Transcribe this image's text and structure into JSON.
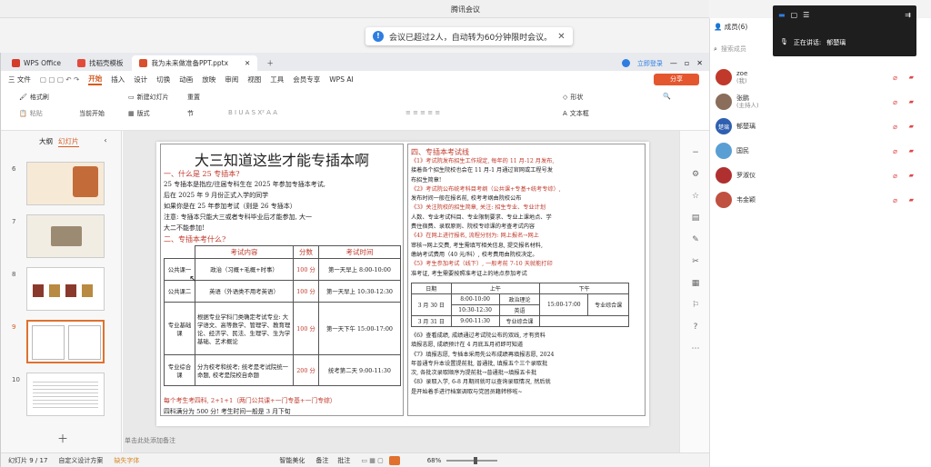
{
  "meeting": {
    "title": "腾讯会议",
    "notice": "会议已超过2人，自动转为60分钟限时会议。",
    "speaking_label": "正在讲话:",
    "speaking_name": "郁楚璃",
    "members_label": "成员(6)",
    "search_placeholder": "搜索成员",
    "participants": [
      {
        "name": "zoe",
        "sub": "(我)",
        "avatar_color": "#c0392b",
        "avatar_text": ""
      },
      {
        "name": "张鹏",
        "sub": "(主持人)",
        "avatar_color": "#8a6d5a",
        "avatar_text": ""
      },
      {
        "name": "郁楚璃",
        "sub": "",
        "avatar_color": "#2f5fb0",
        "avatar_text": "楚璃"
      },
      {
        "name": "国民",
        "sub": "",
        "avatar_color": "#5a9fd4",
        "avatar_text": ""
      },
      {
        "name": "罗淑仪",
        "sub": "",
        "avatar_color": "#b03030",
        "avatar_text": ""
      },
      {
        "name": "韦金颖",
        "sub": "",
        "avatar_color": "#c05040",
        "avatar_text": ""
      }
    ]
  },
  "wps": {
    "tabs": [
      {
        "label": "WPS Office",
        "color": "#d43c2c"
      },
      {
        "label": "找稻壳模板",
        "color": "#e24b3a"
      },
      {
        "label": "我为未来做准备PPT.pptx",
        "color": "#d8502e"
      }
    ],
    "login": "立即登录",
    "menus": [
      "三 文件",
      "开始",
      "插入",
      "设计",
      "切换",
      "动画",
      "放映",
      "审阅",
      "视图",
      "工具",
      "会员专享",
      "WPS AI"
    ],
    "active_menu": "开始",
    "share": "分享",
    "ribbon": {
      "format_painter": "格式刷",
      "paste": "粘贴",
      "from_current": "当前开始",
      "new_slide": "新建幻灯片",
      "layout": "版式",
      "reset": "重置",
      "section": "节",
      "shape": "形状",
      "textbox": "文本框"
    },
    "panel_tabs": [
      "大纲",
      "幻灯片"
    ],
    "slide_numbers": [
      "6",
      "7",
      "8",
      "9",
      "10"
    ],
    "add_note": "单击此处添加备注",
    "status": {
      "slide": "幻灯片 9 / 17",
      "custom": "自定义设计方案",
      "missing_font": "缺失字体",
      "beautify": "智能美化",
      "notes": "备注",
      "comments": "批注",
      "zoom": "68%"
    }
  },
  "slide": {
    "title": "大三知道这些才能专插本啊",
    "sec1": "一、什么是 25 专插本?",
    "p1": "25 专插本是指应/往届专科生在 2025 年参加专插本考试,",
    "p2": "后在 2025 年 9 月份正式入学的同学",
    "p3": "如果你是在 25 年参加考试（则是 26 专插本）",
    "p4": "注意: 专插本只能大三或者专科毕业后才能参加, 大一",
    "p5": "大二不能参加!",
    "sec2": "二、专插本考什么?",
    "table_headers": [
      "考试内容",
      "分数",
      "考试时间"
    ],
    "rows": [
      {
        "name": "公共课一",
        "content": "政治（习概+毛概+时事）",
        "score": "100 分",
        "time": "第一天早上 8:00-10:00"
      },
      {
        "name": "公共课二",
        "content": "英语（外语类不用考英语）",
        "score": "100 分",
        "time": "第一天早上 10:30-12:30"
      },
      {
        "name": "专业基础课",
        "content": "根据专业学科门类确定考试专业: 大学语文、高等数学、管理学、教育理论、经济学、民法、生理学、生为学基础、艺术概论",
        "score": "100 分",
        "time": "第一天下午 15:00-17:00"
      },
      {
        "name": "专业综合课",
        "content": "分为校考和统考; 统考是考试院统一命题, 校考是院校自命题",
        "score": "200 分",
        "time": "统考第二天 9:00-11:30"
      }
    ],
    "foot1": "每个考生考四科, 2+1+1（两门公共课+一门专基+一门专综）",
    "foot2": "四科满分为 500 分! 考生时间一般是 3 月下旬",
    "r_sec": "四、专插本考试线",
    "r_lines": [
      "《1》考试院发布招生工作规定, 每年的 11 月-12 月发布,",
      "接着各个招生院校也会在 11 月-1 月通过官网或工程号发",
      "布招生简章!",
      "《2》考试院公布统考科目考纲（公共课+专基+统考专综）,",
      "发布时间一般在报名前, 校考考纲由院校公布",
      "《3》关注院校的招生简章, 关注: 招生专业、专业计划",
      "人数、专业考试科目、专业限制要求、专业上课地点、学",
      "费住宿费、录取原则、院校专综课的考查考试内容",
      "《4》在网上进行报名, 流程分别为: 网上报名→网上",
      "审核→网上交费, 考生需填写相关信息, 提交报名材料,",
      "缴纳考试费用（40 元/科）, 校考费用由院校决定。",
      "《5》考生参加考试（线下）, 一般考前 7-10 天就能打印",
      "准考证, 考生需要按照准考证上的地点参加考试"
    ],
    "sched_headers": [
      "日期",
      "上午",
      "下午"
    ],
    "sched": [
      {
        "date": "3 月 30 日",
        "t1": "8:00-10:00",
        "s1": "政治理论",
        "t2": "10:30-12:30",
        "s2": "英语",
        "pm_time": "15:00-17:00",
        "pm_subject": "专业综合课"
      },
      {
        "date": "3 月 31 日",
        "t1": "9:00-11:30",
        "s1": "专业综合课"
      }
    ],
    "r_lines2": [
      "《6》查看成绩, 成绩通过考试院公布的双线, 才有资料",
      "填报志愿, 成绩预计在 4 月底五月初即可知道",
      "《7》填报志愿, 专插本采用先公布成绩再填报志愿, 2024",
      "年普通专升本设置提前批, 普通批, 填报五个三个录取批",
      "次, 各批次录取顺序为提前批→普通批→填报五卡批",
      "《8》录取入学, 6-8 月期间就可以查询录取情况, 然后就",
      "是开始着手进行档案调取与党团员籍转移啦~"
    ]
  }
}
